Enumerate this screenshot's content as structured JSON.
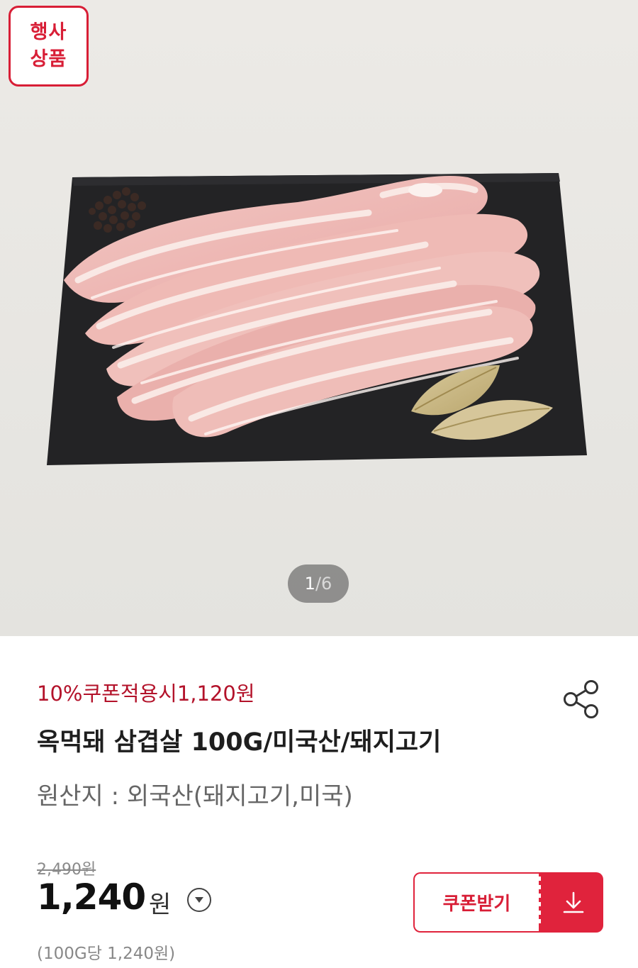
{
  "badge": {
    "line1": "행사",
    "line2": "상품"
  },
  "gallery": {
    "current": "1",
    "separator": "/",
    "total": "6"
  },
  "product": {
    "coupon_price_text": "10%쿠폰적용시1,120원",
    "title": "옥먹돼 삼겹살 100G/미국산/돼지고기",
    "origin": "원산지 : 외국산(돼지고기,미국)"
  },
  "price": {
    "original": "2,490원",
    "sale_amount": "1,240",
    "sale_unit": "원",
    "unit_price": "(100G당 1,240원)"
  },
  "coupon_button": {
    "label": "쿠폰받기"
  },
  "icons": {
    "share": "share-icon",
    "price_info": "chevron-down-circle-icon",
    "download": "download-icon"
  },
  "colors": {
    "brand_red": "#d81e36",
    "coupon_text": "#b3122a",
    "hero_bg": "#e8e7e3",
    "slate": "#232325"
  }
}
